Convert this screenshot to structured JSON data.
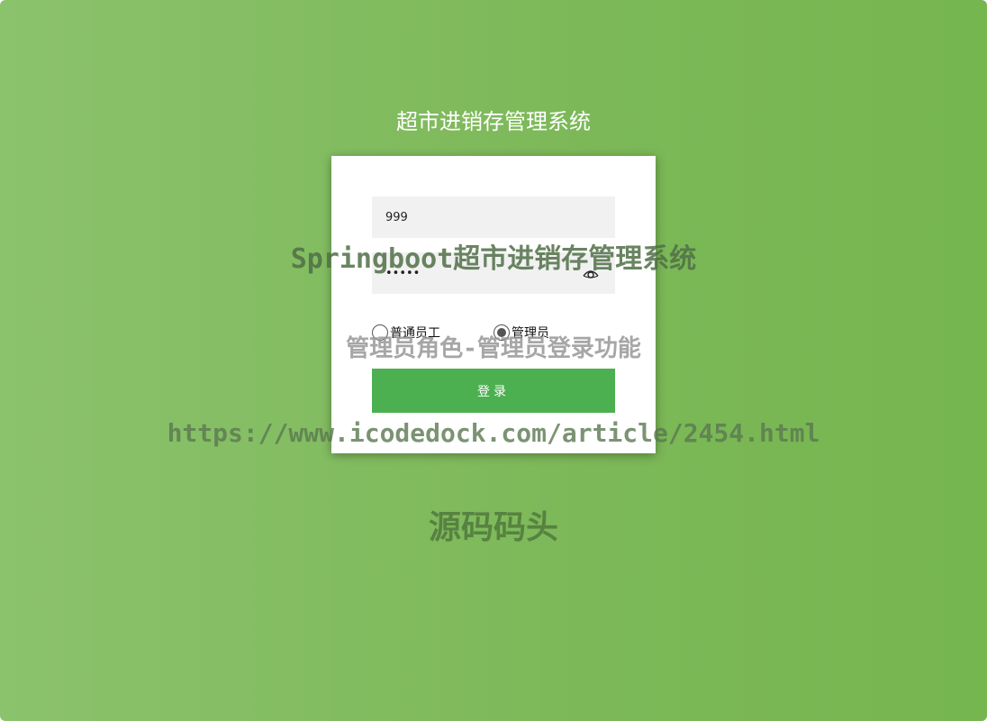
{
  "app": {
    "title": "超市进销存管理系统"
  },
  "login": {
    "username_value": "999",
    "password_value": "•••••",
    "roles": [
      {
        "label": "普通员工",
        "checked": false
      },
      {
        "label": "管理员",
        "checked": true
      }
    ],
    "submit_label": "登录"
  },
  "watermark": {
    "line1": "Springboot超市进销存管理系统",
    "line2": "管理员角色-管理员登录功能",
    "line3": "https://www.icodedock.com/article/2454.html",
    "line4": "源码码头"
  },
  "colors": {
    "background": "#7cb858",
    "button": "#4caf50",
    "field_bg": "#f1f1f1"
  },
  "icons": {
    "password_toggle": "eye-icon"
  }
}
